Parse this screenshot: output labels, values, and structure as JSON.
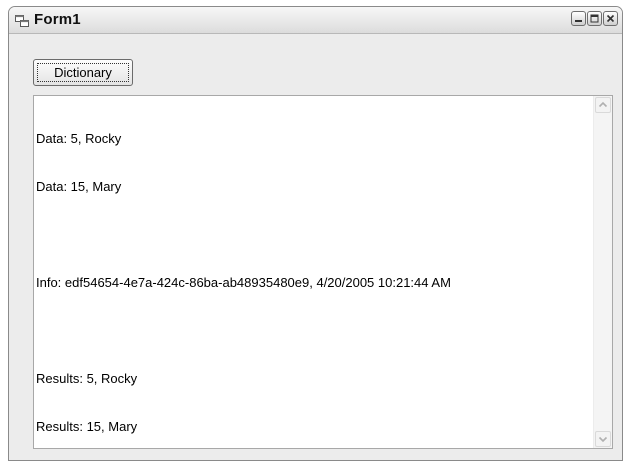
{
  "window": {
    "title": "Form1"
  },
  "buttons": {
    "dictionary_label": "Dictionary"
  },
  "output": {
    "lines": [
      "Data: 5, Rocky",
      "Data: 15, Mary",
      "",
      "Info: edf54654-4e7a-424c-86ba-ab48935480e9, 4/20/2005 10:21:44 AM",
      "",
      "Results: 5, Rocky",
      "Results: 15, Mary"
    ]
  },
  "icons": {
    "app": "form-window-icon",
    "minimize": "minimize-icon",
    "maximize": "maximize-icon",
    "close": "close-icon",
    "scroll_up": "scroll-up-arrow-icon",
    "scroll_down": "scroll-down-arrow-icon"
  }
}
